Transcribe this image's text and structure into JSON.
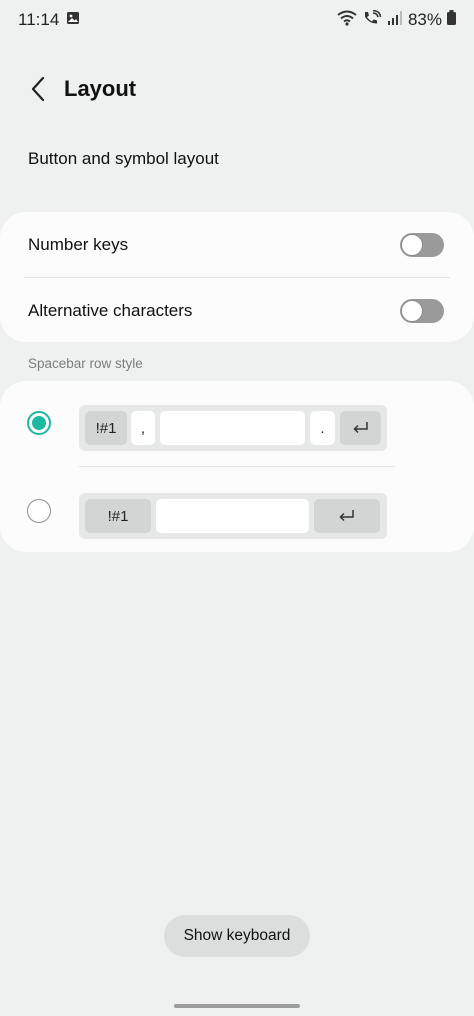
{
  "status_bar": {
    "time": "11:14",
    "battery": "83%",
    "icons": [
      "gallery-icon",
      "wifi-icon",
      "wifi-call-icon",
      "signal-icon",
      "battery-icon"
    ]
  },
  "header": {
    "title": "Layout"
  },
  "section": {
    "label": "Button and symbol layout"
  },
  "toggles": [
    {
      "label": "Number keys",
      "on": false
    },
    {
      "label": "Alternative characters",
      "on": false
    }
  ],
  "spacebar": {
    "label": "Spacebar row style",
    "options": [
      {
        "selected": true,
        "symbol_key": "!#1",
        "comma_key": ",",
        "period_key": "."
      },
      {
        "selected": false,
        "symbol_key": "!#1"
      }
    ]
  },
  "footer": {
    "show_keyboard_label": "Show keyboard"
  },
  "colors": {
    "accent": "#1db8a0",
    "background": "#eef1f0",
    "card": "#fcfcfc"
  }
}
